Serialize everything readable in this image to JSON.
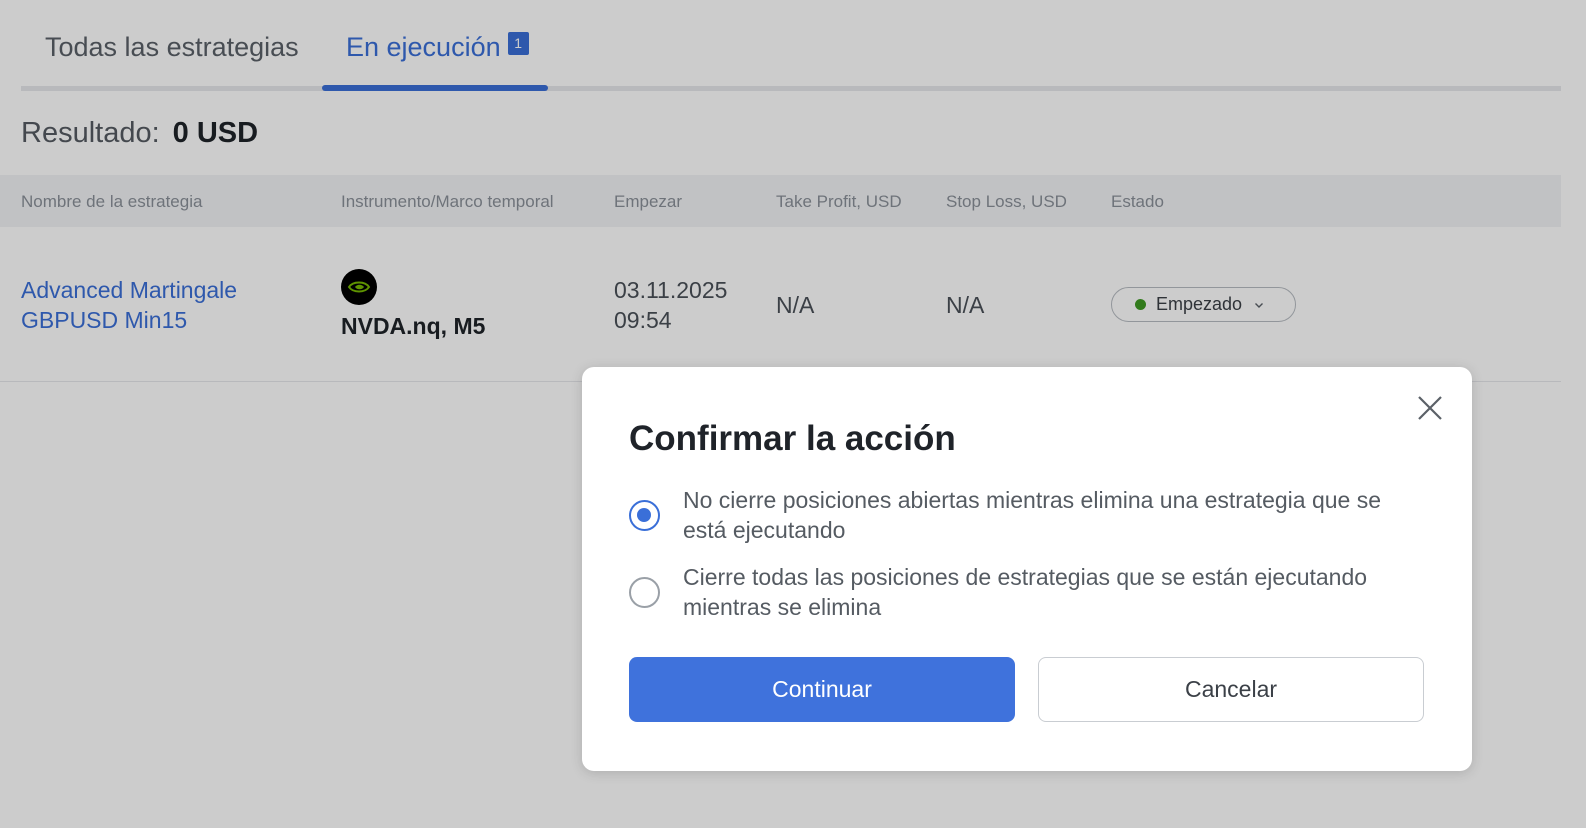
{
  "tabs": {
    "all_label": "Todas las estrategias",
    "running_label": "En ejecución",
    "running_count": "1"
  },
  "result": {
    "label": "Resultado:",
    "value": "0 USD"
  },
  "table": {
    "headers": [
      "Nombre de la estrategia",
      "Instrumento/Marco temporal",
      "Empezar",
      "Take Profit, USD",
      "Stop Loss, USD",
      "Estado"
    ],
    "rows": [
      {
        "name": "Advanced Martingale GBPUSD Min15",
        "instrument_icon": "nvidia-logo-icon",
        "instrument": "NVDA.nq, M5",
        "start": "03.11.2025 09:54",
        "take_profit": "N/A",
        "stop_loss": "N/A",
        "status": "Empezado"
      }
    ]
  },
  "modal": {
    "title": "Confirmar la acción",
    "options": [
      {
        "label": "No cierre posiciones abiertas mientras elimina una estrategia que se está ejecutando",
        "selected": true
      },
      {
        "label": "Cierre todas las posiciones de estrategias que se están ejecutando mientras se elimina",
        "selected": false
      }
    ],
    "continue_label": "Continuar",
    "cancel_label": "Cancelar"
  },
  "colors": {
    "accent": "#3a6fd8",
    "status_green": "#3f9a23",
    "overlay": "rgba(0,0,0,0.2)"
  }
}
